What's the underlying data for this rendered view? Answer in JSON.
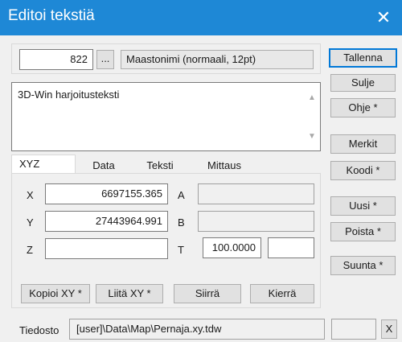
{
  "window": {
    "title": "Editoi tekstiä",
    "close_glyph": "✕"
  },
  "header": {
    "number": "822",
    "browse_label": "...",
    "style_label": "Maastonimi (normaali, 12pt)"
  },
  "text_area": {
    "value": "3D-Win harjoitusteksti"
  },
  "tabs": [
    {
      "label": "XYZ",
      "active": true
    },
    {
      "label": "Data"
    },
    {
      "label": "Teksti"
    },
    {
      "label": "Mittaus"
    }
  ],
  "xyz": {
    "x_label": "X",
    "x_value": "6697155.365",
    "y_label": "Y",
    "y_value": "27443964.991",
    "z_label": "Z",
    "z_value": "",
    "a_label": "A",
    "a_value": "",
    "b_label": "B",
    "b_value": "",
    "t_label": "T",
    "t_value": "100.0000",
    "t_extra": ""
  },
  "tab_buttons": {
    "copy": "Kopioi XY *",
    "paste": "Liitä XY *",
    "move": "Siirrä",
    "rotate": "Kierrä"
  },
  "file": {
    "label": "Tiedosto",
    "path": "[user]\\Data\\Map\\Pernaja.xy.tdw",
    "extra": "",
    "x_button": "X"
  },
  "side_buttons": {
    "save": "Tallenna",
    "close": "Sulje",
    "help": "Ohje *",
    "marks": "Merkit",
    "code": "Koodi *",
    "new": "Uusi *",
    "delete": "Poista *",
    "direction": "Suunta *"
  },
  "colors": {
    "titlebar": "#1e88d6",
    "window_bg": "#f0f0f0",
    "default_button_border": "#0078d7"
  }
}
